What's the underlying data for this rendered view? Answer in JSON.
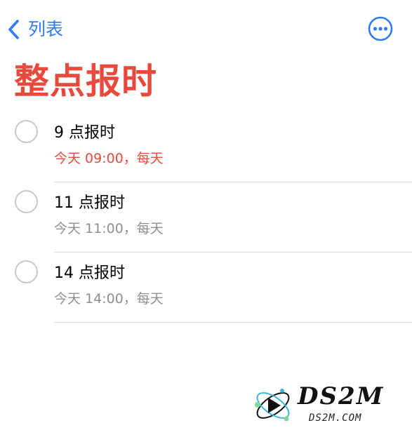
{
  "nav": {
    "back_label": "列表",
    "back_icon": "chevron-left-icon",
    "more_icon": "ellipsis-circle-icon"
  },
  "title": "整点报时",
  "items": [
    {
      "title": "9 点报时",
      "subtitle": "今天 09:00，每天",
      "overdue": true
    },
    {
      "title": "11 点报时",
      "subtitle": "今天 11:00，每天",
      "overdue": false
    },
    {
      "title": "14 点报时",
      "subtitle": "今天 14:00，每天",
      "overdue": false
    }
  ],
  "watermark": {
    "brand": "DS2M",
    "domain": "DS2M.COM"
  },
  "colors": {
    "accent": "#2f7cf6",
    "title": "#e64a3c",
    "overdue": "#e64a3c",
    "secondary_text": "#8e8e93",
    "checkbox_border": "#c7c7cc"
  }
}
